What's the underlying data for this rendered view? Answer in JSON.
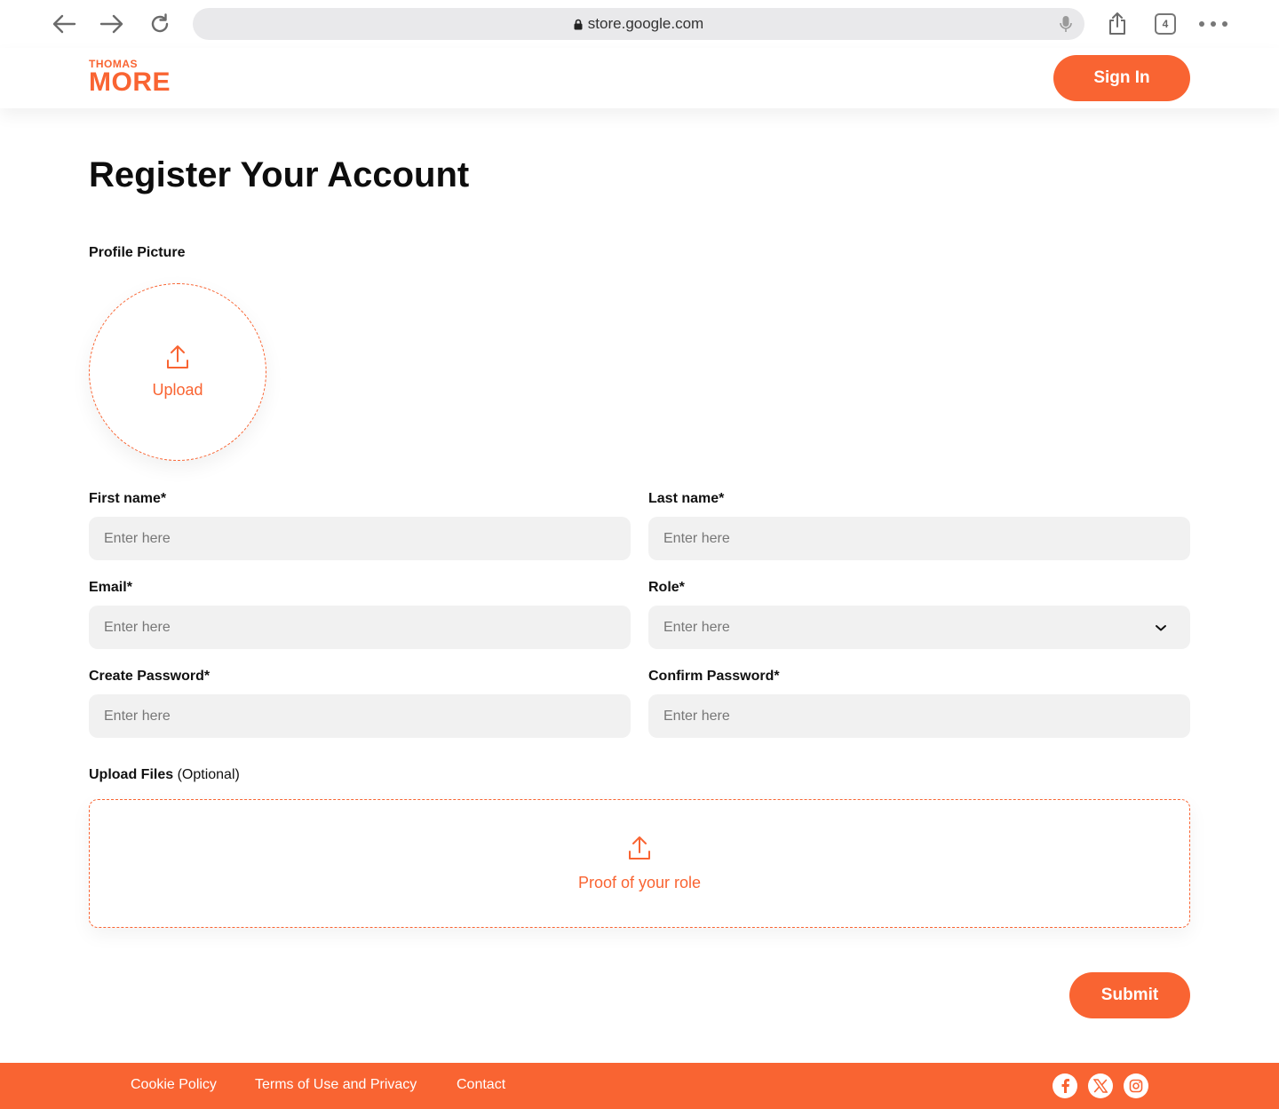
{
  "browser": {
    "url": "store.google.com",
    "tab_count": "4"
  },
  "header": {
    "logo_top": "THOMAS",
    "logo_bottom": "MORE",
    "sign_in_label": "Sign In"
  },
  "main": {
    "title": "Register Your Account",
    "profile_picture_label": "Profile Picture",
    "profile_upload_text": "Upload",
    "fields": {
      "first_name": {
        "label": "First name*",
        "placeholder": "Enter here"
      },
      "last_name": {
        "label": "Last name*",
        "placeholder": "Enter here"
      },
      "email": {
        "label": "Email*",
        "placeholder": "Enter here"
      },
      "role": {
        "label": "Role*",
        "placeholder": "Enter here"
      },
      "create_password": {
        "label": "Create Password*",
        "placeholder": "Enter here"
      },
      "confirm_password": {
        "label": "Confirm Password*",
        "placeholder": "Enter here"
      }
    },
    "upload_files_label": "Upload Files",
    "upload_files_optional": "(Optional)",
    "upload_files_text": "Proof of your role",
    "submit_label": "Submit"
  },
  "footer": {
    "links": [
      "Cookie Policy",
      "Terms of Use and Privacy",
      "Contact"
    ],
    "social_icons": [
      "facebook-icon",
      "x-icon",
      "instagram-icon"
    ]
  },
  "colors": {
    "accent": "#f96432",
    "input_bg": "#f1f1f1"
  }
}
